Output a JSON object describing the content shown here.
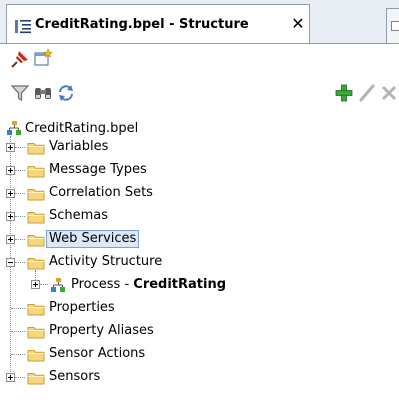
{
  "window": {
    "tab_title": "CreditRating.bpel - Structure",
    "tab_close_glyph": "✕"
  },
  "toolbar_primary": {
    "icons": [
      "pin-icon",
      "new-view-icon"
    ]
  },
  "toolbar_secondary": {
    "left_icons": [
      "filter-icon",
      "binoculars-icon",
      "sync-icon"
    ],
    "right_icons": [
      "add-icon",
      "edit-icon",
      "delete-icon"
    ]
  },
  "tree": {
    "root_label": "CreditRating.bpel",
    "variables": "Variables",
    "message_types": "Message Types",
    "correlation_sets": "Correlation Sets",
    "schemas": "Schemas",
    "web_services": "Web Services",
    "activity_structure": "Activity Structure",
    "process_prefix": "Process - ",
    "process_name": "CreditRating",
    "properties": "Properties",
    "property_aliases": "Property Aliases",
    "sensor_actions": "Sensor Actions",
    "sensors": "Sensors",
    "selected_item": "Web Services"
  },
  "colors": {
    "folder_fill": "#f7d77e",
    "folder_edge": "#c8a03a",
    "selection_bg": "#dce8f7",
    "selection_border": "#7da2ce",
    "add_green": "#3ca838",
    "disabled_gray": "#b4b4b4"
  }
}
